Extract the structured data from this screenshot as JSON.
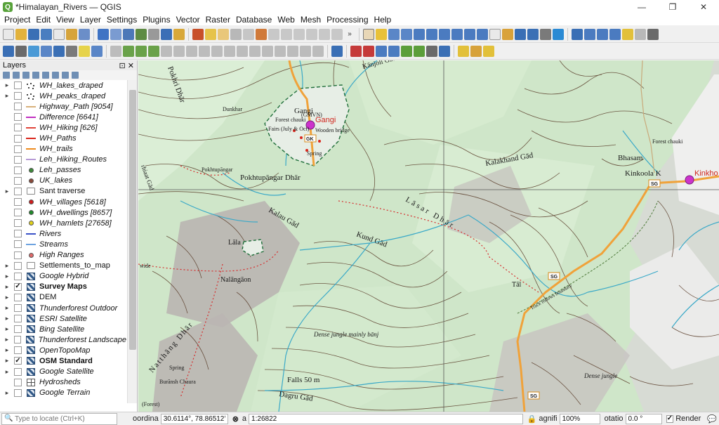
{
  "window": {
    "title": "*Himalayan_Rivers — QGIS",
    "controls": [
      "—",
      "❐",
      "✕"
    ]
  },
  "menus": [
    "Project",
    "Edit",
    "View",
    "Layer",
    "Settings",
    "Plugins",
    "Vector",
    "Raster",
    "Database",
    "Web",
    "Mesh",
    "Processing",
    "Help"
  ],
  "layers_panel": {
    "title": "Layers",
    "header_icons": "⊡ ✕",
    "layers": [
      {
        "name": "WH_lakes_draped",
        "checked": false,
        "expander": "▸",
        "style": "italic",
        "symbol": "points"
      },
      {
        "name": "WH_peaks_draped",
        "checked": false,
        "expander": "▸",
        "style": "italic",
        "symbol": "points"
      },
      {
        "name": "Highway_Path [9054]",
        "checked": false,
        "expander": "",
        "style": "italic",
        "symbol": "line",
        "color": "#d8b07a"
      },
      {
        "name": "Difference [6641]",
        "checked": false,
        "expander": "",
        "style": "italic",
        "symbol": "line",
        "color": "#c02fc0"
      },
      {
        "name": "WH_Hiking [626]",
        "checked": false,
        "expander": "",
        "style": "italic",
        "symbol": "line",
        "color": "#e0443a"
      },
      {
        "name": "WH_Paths",
        "checked": false,
        "expander": "",
        "style": "italic",
        "symbol": "line",
        "color": "#d9261c"
      },
      {
        "name": "WH_trails",
        "checked": false,
        "expander": "",
        "style": "italic",
        "symbol": "line",
        "color": "#ee8b1e"
      },
      {
        "name": "Leh_Hiking_Routes",
        "checked": false,
        "expander": "",
        "style": "italic",
        "symbol": "line",
        "color": "#b79ad6"
      },
      {
        "name": "Leh_passes",
        "checked": false,
        "expander": "",
        "style": "italic",
        "symbol": "dot",
        "color": "#3d8a3a"
      },
      {
        "name": "UK_lakes",
        "checked": false,
        "expander": "",
        "style": "italic",
        "symbol": "dot",
        "color": "#8a4a3a"
      },
      {
        "name": "Sant traverse",
        "checked": false,
        "expander": "▸",
        "style": "normal",
        "symbol": "group"
      },
      {
        "name": "WH_villages [5618]",
        "checked": false,
        "expander": "",
        "style": "italic",
        "symbol": "dot",
        "color": "#d21c1c"
      },
      {
        "name": "WH_dwellings [8657]",
        "checked": false,
        "expander": "",
        "style": "italic",
        "symbol": "dot",
        "color": "#1f8a2a"
      },
      {
        "name": "WH_hamlets [27658]",
        "checked": false,
        "expander": "",
        "style": "italic",
        "symbol": "dot",
        "color": "#e2d21a"
      },
      {
        "name": "Rivers",
        "checked": false,
        "expander": "",
        "style": "italic",
        "symbol": "line",
        "color": "#3a52c8"
      },
      {
        "name": "Streams",
        "checked": false,
        "expander": "",
        "style": "italic",
        "symbol": "line",
        "color": "#6ea3e0"
      },
      {
        "name": "High Ranges",
        "checked": false,
        "expander": "",
        "style": "italic",
        "symbol": "dot",
        "color": "#e06a6a"
      },
      {
        "name": "Settlements_to_map",
        "checked": false,
        "expander": "▸",
        "style": "normal",
        "symbol": "group"
      },
      {
        "name": "Google Hybrid",
        "checked": false,
        "expander": "▸",
        "style": "italic",
        "symbol": "raster"
      },
      {
        "name": "Survey Maps",
        "checked": true,
        "expander": "▸",
        "style": "bold",
        "symbol": "raster"
      },
      {
        "name": "DEM",
        "checked": false,
        "expander": "▸",
        "style": "normal",
        "symbol": "raster"
      },
      {
        "name": "Thunderforest Outdoor",
        "checked": false,
        "expander": "▸",
        "style": "italic",
        "symbol": "raster"
      },
      {
        "name": "ESRI Satellite",
        "checked": false,
        "expander": "▸",
        "style": "italic",
        "symbol": "raster"
      },
      {
        "name": "Bing Satellite",
        "checked": false,
        "expander": "▸",
        "style": "italic",
        "symbol": "raster"
      },
      {
        "name": "Thunderforest Landscape",
        "checked": false,
        "expander": "▸",
        "style": "italic",
        "symbol": "raster"
      },
      {
        "name": "OpenTopoMap",
        "checked": false,
        "expander": "▸",
        "style": "italic",
        "symbol": "raster"
      },
      {
        "name": "OSM Standard",
        "checked": true,
        "expander": "▸",
        "style": "bold",
        "symbol": "raster"
      },
      {
        "name": "Google Satellite",
        "checked": false,
        "expander": "▸",
        "style": "italic",
        "symbol": "raster"
      },
      {
        "name": "Hydrosheds",
        "checked": false,
        "expander": "",
        "style": "italic",
        "symbol": "grid"
      },
      {
        "name": "Google Terrain",
        "checked": false,
        "expander": "▸",
        "style": "italic",
        "symbol": "raster"
      }
    ]
  },
  "map_labels": {
    "gangi": "Gangi",
    "gangi_red": "Gangi",
    "gmvn": "(GMVN)",
    "forest_chauki": "Forest chauki",
    "fairs": "Fairs (July & Oct)",
    "wooden_bridge": "Wooden bridge",
    "spring1": "Spring",
    "gk": "GK",
    "dunkhar": "Dunkhar",
    "pokhri_dhar": "Pokhri Dhār",
    "kanjoli": "Kānjoli Gād",
    "pokhtupangar": "Pokhtupāngar",
    "pokhtupangar_dhar": "Pokhtupāngar Dhār",
    "kalakhand": "Kalakhand Gād",
    "bhasam": "Bhasam",
    "forest_chauki2": "Forest chauki",
    "kinkoola": "Kinkoola K",
    "kinkho": "Kinkho",
    "sg1": "SG",
    "sg2": "SG",
    "sg3": "SG",
    "kalau": "Kalau Gād",
    "lasar_dhar": "Lāsar Dhār",
    "kund_gad": "Kund Gād",
    "lala": "Lāla",
    "nalangaon": "Nalāngāon",
    "taal": "Tāl",
    "track": "Track follows boundary",
    "dense1": "Dense jungle mainly bānj",
    "dense2": "Dense jungle",
    "natthang": "Natthāng Dhār",
    "spring2": "Spring",
    "buransh": "Burānsh Chaura",
    "falls": "Falls  50  m",
    "dagru": "Dagru Gād",
    "forest_bl": "(Forest)",
    "wide": "wide",
    "kiaat": "rhiaat Gād"
  },
  "statusbar": {
    "locate_placeholder": "Type to locate (Ctrl+K)",
    "coordinate_label": "oordina",
    "coordinate_value": "30.6114°, 78.86512°",
    "scale_label": "a",
    "scale_value": "1:26822",
    "magnifier_label": "agnifi",
    "magnifier_value": "100%",
    "rotation_label": "otatio",
    "rotation_value": "0.0 °",
    "render_label": "Render"
  },
  "colors": {
    "map_green": "#cfe6c9",
    "contour": "#5a3d2a",
    "river": "#3aa9c8",
    "road": "#f0a23a",
    "trail": "#d62d2d",
    "poi": "#cc33cc"
  }
}
